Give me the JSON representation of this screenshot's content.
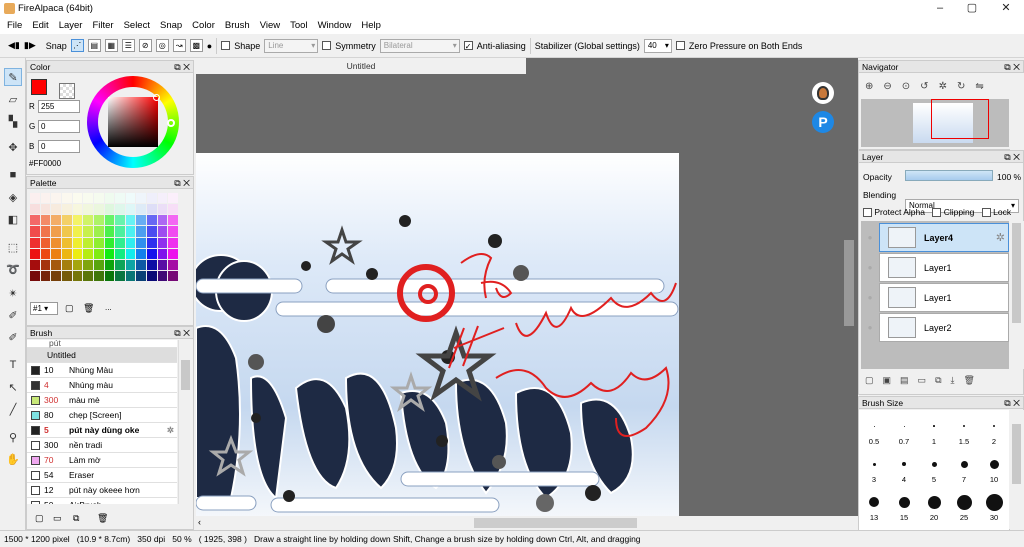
{
  "window": {
    "title": "FireAlpaca (64bit)",
    "minimize": "–",
    "maximize": "▢",
    "close": "✕"
  },
  "menu": [
    "File",
    "Edit",
    "Layer",
    "Filter",
    "Select",
    "Snap",
    "Color",
    "Brush",
    "View",
    "Tool",
    "Window",
    "Help"
  ],
  "toolbar": {
    "snap_label": "Snap",
    "shape_label": "Shape",
    "shape_value": "Line",
    "symmetry_label": "Symmetry",
    "symmetry_value": "Bilateral",
    "antialias_label": "Anti-aliasing",
    "stabilizer_label": "Stabilizer (Global settings)",
    "stabilizer_value": "40",
    "zero_pressure_label": "Zero Pressure on Both Ends"
  },
  "color_panel": {
    "title": "Color",
    "r_label": "R",
    "g_label": "G",
    "b_label": "B",
    "r": "255",
    "g": "0",
    "b": "0",
    "hex": "#FF0000",
    "foreground": "#ff0000"
  },
  "palette_panel": {
    "title": "Palette",
    "selector": "#1",
    "more": "..."
  },
  "brush_panel": {
    "title": "Brush",
    "partial_top": "pút",
    "group": "Untitled",
    "items": [
      {
        "size": "10",
        "name": "Nhúng Màu",
        "color": "#222222"
      },
      {
        "size": "4",
        "name": "Nhúng màu",
        "color": "#333333",
        "size_color": "#d03030"
      },
      {
        "size": "300",
        "name": "màu mè",
        "color": "#c8e878",
        "size_color": "#d03030"
      },
      {
        "size": "80",
        "name": "chẹp [Screen]",
        "color": "#7fe3e3"
      },
      {
        "size": "5",
        "name": "pút này dùng oke",
        "color": "#222222",
        "size_color": "#d03030",
        "selected": true
      },
      {
        "size": "300",
        "name": "nền tradi",
        "color": "#ffffff"
      },
      {
        "size": "70",
        "name": "Làm mờ",
        "color": "#f0a8f0",
        "size_color": "#d03030"
      },
      {
        "size": "54",
        "name": "Eraser",
        "color": "#ffffff"
      },
      {
        "size": "12",
        "name": "pút này okeee hơn",
        "color": "#ffffff"
      },
      {
        "size": "50",
        "name": "AirBrush",
        "color": "#ffffff"
      }
    ]
  },
  "canvas": {
    "tab": "Untitled"
  },
  "navigator": {
    "title": "Navigator"
  },
  "layer_panel": {
    "title": "Layer",
    "opacity_label": "Opacity",
    "opacity_value": "100 %",
    "blending_label": "Blending",
    "blending_value": "Normal",
    "protect_alpha": "Protect Alpha",
    "clipping": "Clipping",
    "lock": "Lock",
    "layers": [
      {
        "name": "Layer4",
        "selected": true
      },
      {
        "name": "Layer1"
      },
      {
        "name": "Layer1"
      },
      {
        "name": "Layer2"
      }
    ]
  },
  "brush_size_panel": {
    "title": "Brush Size",
    "sizes": [
      "0.5",
      "0.7",
      "1",
      "1.5",
      "2",
      "3",
      "4",
      "5",
      "7",
      "10",
      "13",
      "15",
      "20",
      "25",
      "30"
    ]
  },
  "status": {
    "dimensions": "1500 * 1200 pixel",
    "physical": "(10.9 * 8.7cm)",
    "dpi": "350 dpi",
    "zoom": "50 %",
    "coords": "( 1925, 398 )",
    "hint": "Draw a straight line by holding down Shift, Change a brush size by holding down Ctrl, Alt, and dragging"
  }
}
